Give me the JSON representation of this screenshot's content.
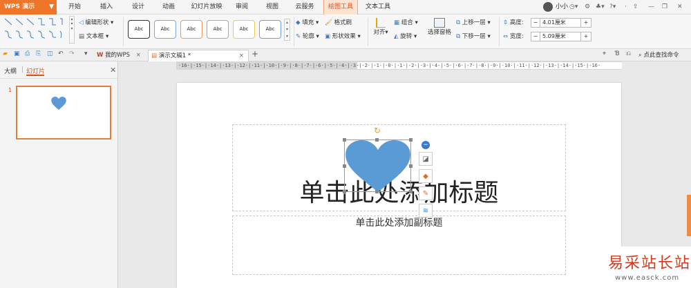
{
  "app": {
    "title": "WPS 演示"
  },
  "menu": {
    "tabs": [
      "开始",
      "插入",
      "设计",
      "动画",
      "幻灯片放映",
      "审阅",
      "视图",
      "云服务",
      "绘图工具",
      "文本工具"
    ],
    "user": "小小"
  },
  "ribbon": {
    "edit_shape": "编辑形状",
    "text_box": "文本框",
    "style_sample": "Abc",
    "fill": "填充",
    "outline": "轮廓",
    "format_brush": "格式刷",
    "shape_effect": "形状效果",
    "align": "对齐",
    "group": "组合",
    "rotate": "旋转",
    "selection_pane": "选择窗格",
    "bring_forward": "上移一层",
    "send_backward": "下移一层",
    "height_label": "高度:",
    "height_value": "4.01厘米",
    "width_label": "宽度:",
    "width_value": "5.09厘米",
    "minus": "−",
    "plus": "+"
  },
  "doctabs": {
    "my_wps": "我的WPS",
    "current": "演示文稿1 *",
    "find_command": "点此查找命令"
  },
  "left_panel": {
    "tab_outline": "大纲",
    "tab_slides": "幻灯片",
    "slide_number": "1"
  },
  "ruler": {
    "text": "·16·|·15·|·14·|·13·|·12·|·11·|·10·|·9·|·8·|·7·|·6·|·5·|·4·|·3·|·2·|·1·|·0·|·1·|·2·|·3·|·4·|·5·|·6·|·7·|·8·|·9·|·10·|·11·|·12·|·13·|·14·|·15·|·16·"
  },
  "slide": {
    "title_placeholder": "单击此处添加标题",
    "subtitle_placeholder": "单击此处添加副标题"
  },
  "watermark": {
    "text": "易采站长站",
    "url": "www.easck.com"
  },
  "colors": {
    "accent": "#ef7528",
    "heart": "#5b9bd5"
  }
}
